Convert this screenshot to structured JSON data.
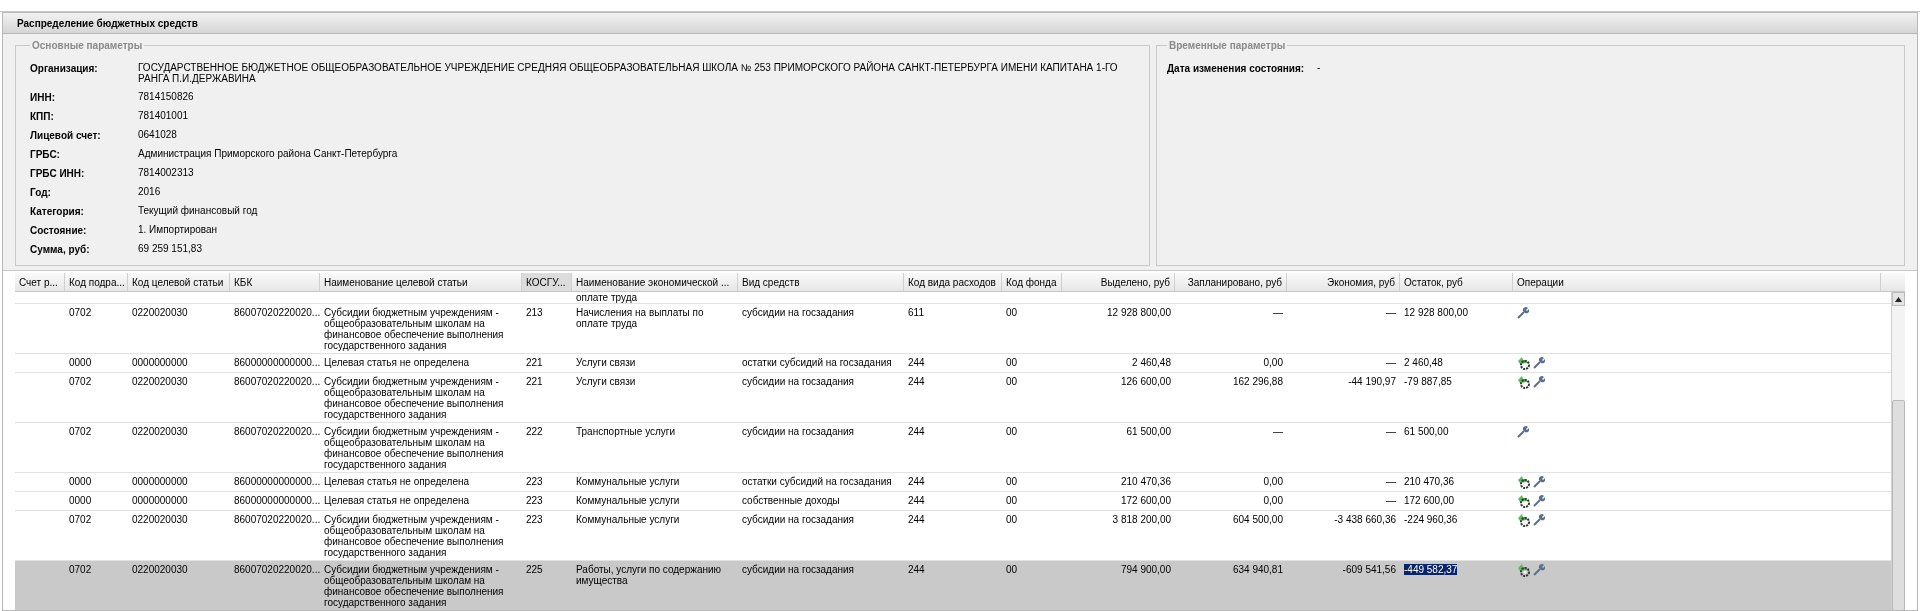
{
  "window": {
    "title": "Распределение бюджетных средств"
  },
  "main_params": {
    "legend": "Основные параметры",
    "fields": [
      {
        "label": "Организация:",
        "value": "ГОСУДАРСТВЕННОЕ БЮДЖЕТНОЕ ОБЩЕОБРАЗОВАТЕЛЬНОЕ УЧРЕЖДЕНИЕ СРЕДНЯЯ ОБЩЕОБРАЗОВАТЕЛЬНАЯ ШКОЛА № 253 ПРИМОРСКОГО РАЙОНА САНКТ-ПЕТЕРБУРГА ИМЕНИ КАПИТАНА 1-ГО РАНГА П.И.ДЕРЖАВИНА"
      },
      {
        "label": "ИНН:",
        "value": "7814150826"
      },
      {
        "label": "КПП:",
        "value": "781401001"
      },
      {
        "label": "Лицевой счет:",
        "value": "0641028"
      },
      {
        "label": "ГРБС:",
        "value": "Администрация Приморского района Санкт-Петербурга"
      },
      {
        "label": "ГРБС ИНН:",
        "value": "7814002313"
      },
      {
        "label": "Год:",
        "value": "2016"
      },
      {
        "label": "Категория:",
        "value": "Текущий финансовый год"
      },
      {
        "label": "Состояние:",
        "value": "1. Импортирован"
      },
      {
        "label": "Сумма, руб:",
        "value": "69 259 151,83"
      }
    ]
  },
  "temp_params": {
    "legend": "Временные параметры",
    "fields": [
      {
        "label": "Дата изменения состояния:",
        "value": "-"
      }
    ]
  },
  "table": {
    "columns": [
      {
        "label": "Счет р...",
        "sorted": false
      },
      {
        "label": "Код подра...",
        "sorted": false
      },
      {
        "label": "Код целевой статьи",
        "sorted": false
      },
      {
        "label": "КБК",
        "sorted": false
      },
      {
        "label": "Наименование целевой статьи",
        "sorted": false
      },
      {
        "label": "КОСГУ...",
        "sorted": true
      },
      {
        "label": "Наименование экономической ...",
        "sorted": false
      },
      {
        "label": "Вид средств",
        "sorted": false
      },
      {
        "label": "Код вида расходов",
        "sorted": false
      },
      {
        "label": "Код фонда",
        "sorted": false
      },
      {
        "label": "Выделено, руб",
        "sorted": false
      },
      {
        "label": "Запланировано, руб",
        "sorted": false
      },
      {
        "label": "Экономия, руб",
        "sorted": false
      },
      {
        "label": "Остаток, руб",
        "sorted": false
      },
      {
        "label": "Операции",
        "sorted": false
      }
    ],
    "rows": [
      {
        "selected": false,
        "cells": [
          "",
          "",
          "",
          "",
          "",
          "",
          "оплате труда",
          "",
          "",
          "",
          "",
          "",
          "",
          "",
          ""
        ]
      },
      {
        "selected": false,
        "cells": [
          "",
          "0702",
          "0220020030",
          "86007020220020...",
          "Субсидии бюджетным учреждениям - общеобразовательным школам на финансовое обеспечение выполнения государственного задания",
          "213",
          "Начисления на выплаты по оплате труда",
          "субсидии на госзадания",
          "611",
          "00",
          "12 928 800,00",
          "—",
          "—",
          "12 928 800,00"
        ],
        "operations": [
          {
            "kind": "wrench"
          }
        ]
      },
      {
        "selected": false,
        "cells": [
          "",
          "0000",
          "0000000000",
          "86000000000000...",
          "Целевая статья не определена",
          "221",
          "Услуги связи",
          "остатки субсидий на госзадания",
          "244",
          "00",
          "2 460,48",
          "0,00",
          "—",
          "2 460,48"
        ],
        "operations": [
          {
            "kind": "gear"
          },
          {
            "kind": "wrench"
          }
        ]
      },
      {
        "selected": false,
        "cells": [
          "",
          "0702",
          "0220020030",
          "86007020220020...",
          "Субсидии бюджетным учреждениям - общеобразовательным школам на финансовое обеспечение выполнения государственного задания",
          "221",
          "Услуги связи",
          "субсидии на госзадания",
          "244",
          "00",
          "126 600,00",
          "162 296,88",
          "-44 190,97",
          "-79 887,85"
        ],
        "operations": [
          {
            "kind": "gear"
          },
          {
            "kind": "wrench"
          }
        ]
      },
      {
        "selected": false,
        "cells": [
          "",
          "0702",
          "0220020030",
          "86007020220020...",
          "Субсидии бюджетным учреждениям - общеобразовательным школам на финансовое обеспечение выполнения государственного задания",
          "222",
          "Транспортные услуги",
          "субсидии на госзадания",
          "244",
          "00",
          "61 500,00",
          "—",
          "—",
          "61 500,00"
        ],
        "operations": [
          {
            "kind": "wrench"
          }
        ]
      },
      {
        "selected": false,
        "cells": [
          "",
          "0000",
          "0000000000",
          "86000000000000...",
          "Целевая статья не определена",
          "223",
          "Коммунальные услуги",
          "остатки субсидий на госзадания",
          "244",
          "00",
          "210 470,36",
          "0,00",
          "—",
          "210 470,36"
        ],
        "operations": [
          {
            "kind": "gear"
          },
          {
            "kind": "wrench"
          }
        ]
      },
      {
        "selected": false,
        "cells": [
          "",
          "0000",
          "0000000000",
          "86000000000000...",
          "Целевая статья не определена",
          "223",
          "Коммунальные услуги",
          "собственные доходы",
          "244",
          "00",
          "172 600,00",
          "0,00",
          "—",
          "172 600,00"
        ],
        "operations": [
          {
            "kind": "gear"
          },
          {
            "kind": "wrench"
          }
        ]
      },
      {
        "selected": false,
        "cells": [
          "",
          "0702",
          "0220020030",
          "86007020220020...",
          "Субсидии бюджетным учреждениям - общеобразовательным школам на финансовое обеспечение выполнения государственного задания",
          "223",
          "Коммунальные услуги",
          "субсидии на госзадания",
          "244",
          "00",
          "3 818 200,00",
          "604 500,00",
          "-3 438 660,36",
          "-224 960,36"
        ],
        "operations": [
          {
            "kind": "gear"
          },
          {
            "kind": "wrench"
          }
        ]
      },
      {
        "selected": true,
        "cells": [
          "",
          "0702",
          "0220020030",
          "86007020220020...",
          "Субсидии бюджетным учреждениям - общеобразовательным школам на финансовое обеспечение выполнения государственного задания",
          "225",
          "Работы, услуги по содержанию имущества",
          "субсидии на госзадания",
          "244",
          "00",
          "794 900,00",
          "634 940,81",
          "-609 541,56",
          "-449 582,37"
        ],
        "operations": [
          {
            "kind": "gear"
          },
          {
            "kind": "wrench"
          }
        ]
      }
    ]
  }
}
